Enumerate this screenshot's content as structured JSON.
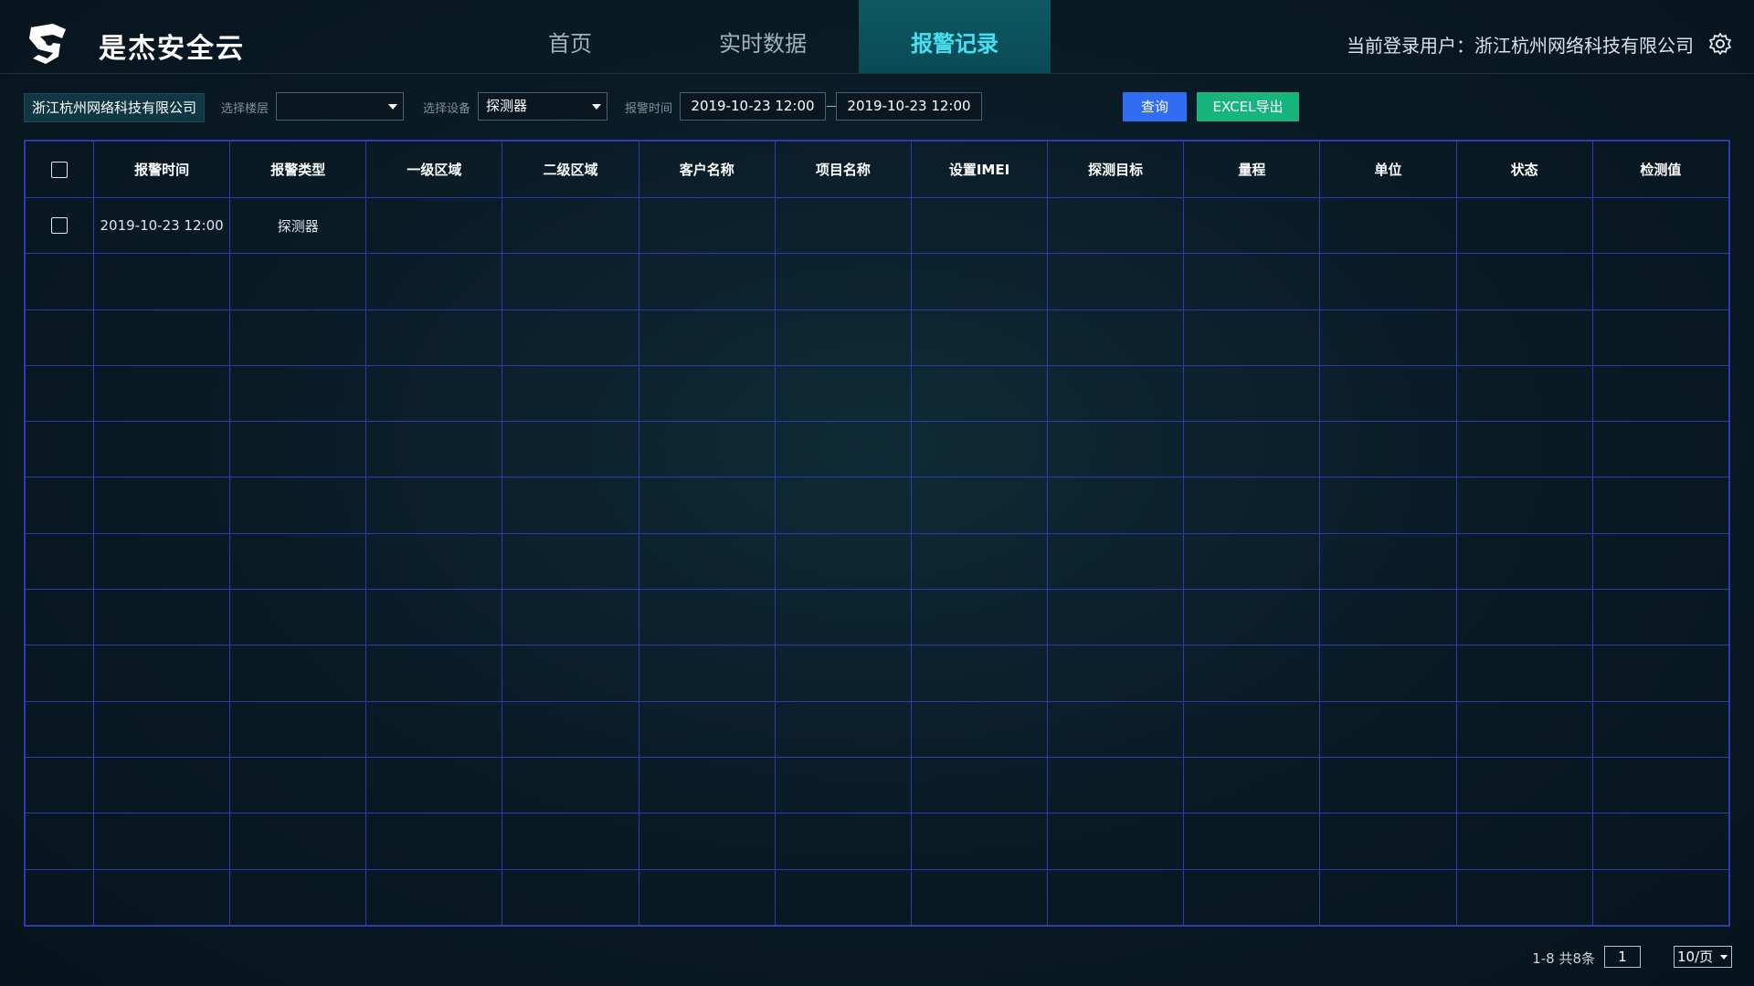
{
  "header": {
    "app_title": "是杰安全云",
    "tabs": [
      {
        "label": "首页"
      },
      {
        "label": "实时数据"
      },
      {
        "label": "报警记录"
      }
    ],
    "active_tab": "报警记录",
    "user_label": "当前登录用户：浙江杭州网络科技有限公司"
  },
  "filters": {
    "company": "浙江杭州网络科技有限公司",
    "floor_label": "选择楼层",
    "floor_value": "",
    "device_label": "选择设备",
    "device_value": "探测器",
    "time_label": "报警时间",
    "start_time": "2019-10-23 12:00",
    "end_time": "2019-10-23 12:00",
    "query_button": "查询",
    "export_button": "EXCEL导出"
  },
  "table": {
    "columns": [
      "报警时间",
      "报警类型",
      "一级区域",
      "二级区域",
      "客户名称",
      "项目名称",
      "设置IMEI",
      "探测目标",
      "量程",
      "单位",
      "状态",
      "检测值"
    ],
    "rows": [
      [
        "2019-10-23 12:00",
        "探测器",
        "",
        "",
        "",
        "",
        "",
        "",
        "",
        "",
        "",
        ""
      ]
    ],
    "empty_rows": 12
  },
  "pagination": {
    "info": "1-8 共8条",
    "current_page": "1",
    "page_size": "10/页"
  },
  "colors": {
    "accent": "#47e0f2",
    "active_tab_bg": "#0a4a55",
    "query_button": "#2f6df2",
    "export_button": "#17b57d",
    "grid_line": "#2c3cb0"
  }
}
